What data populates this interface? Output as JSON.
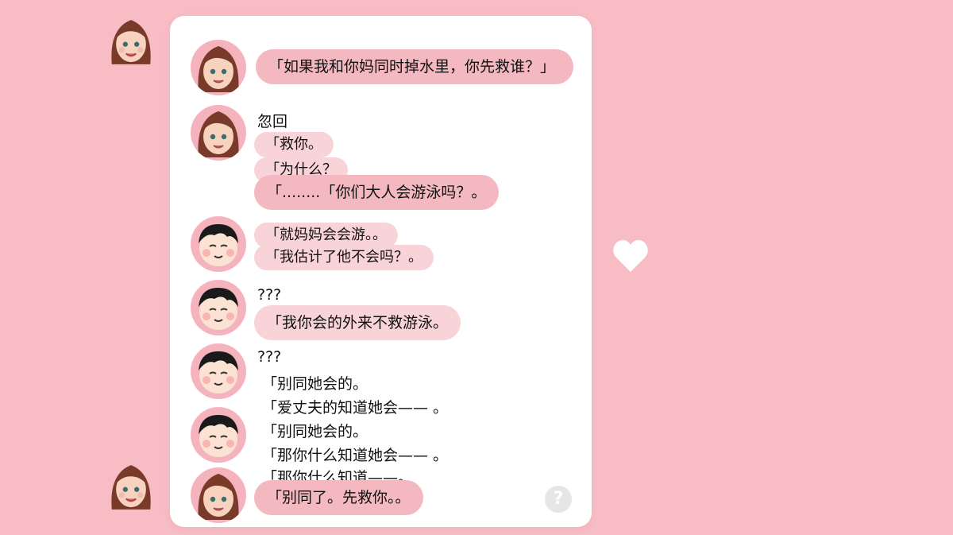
{
  "messages": {
    "m1": "「如果我和你妈同时掉水里，你先救谁？」",
    "m2_header": "忽回",
    "m2_a": "「救你。",
    "m2_b": "「为什么？",
    "m2_c": "「........「你们大人会游泳吗？。",
    "m3_a": "「就妈妈会会游。。",
    "m3_b": "「我估计了他不会吗？。",
    "m4_header": "???",
    "m4_a": "「我你会的外来不救游泳。",
    "m5_header": "???",
    "m5_a": "「别同她会的。",
    "m5_b": "「爱丈夫的知道她会—— 。",
    "m6_a": "「别同她会的。",
    "m6_b": "「那你什么知道她会—— 。",
    "m7_a": "「那你什么知道——。",
    "m7_b": "「别同了。先救你。。"
  },
  "icons": {
    "heart": "heart-icon",
    "help": "help-icon"
  },
  "help_label": "?",
  "colors": {
    "background": "#f7bcc4",
    "card": "#ffffff",
    "bubble": "#f8d3d8",
    "bubble_strong": "#f4b8c1"
  }
}
